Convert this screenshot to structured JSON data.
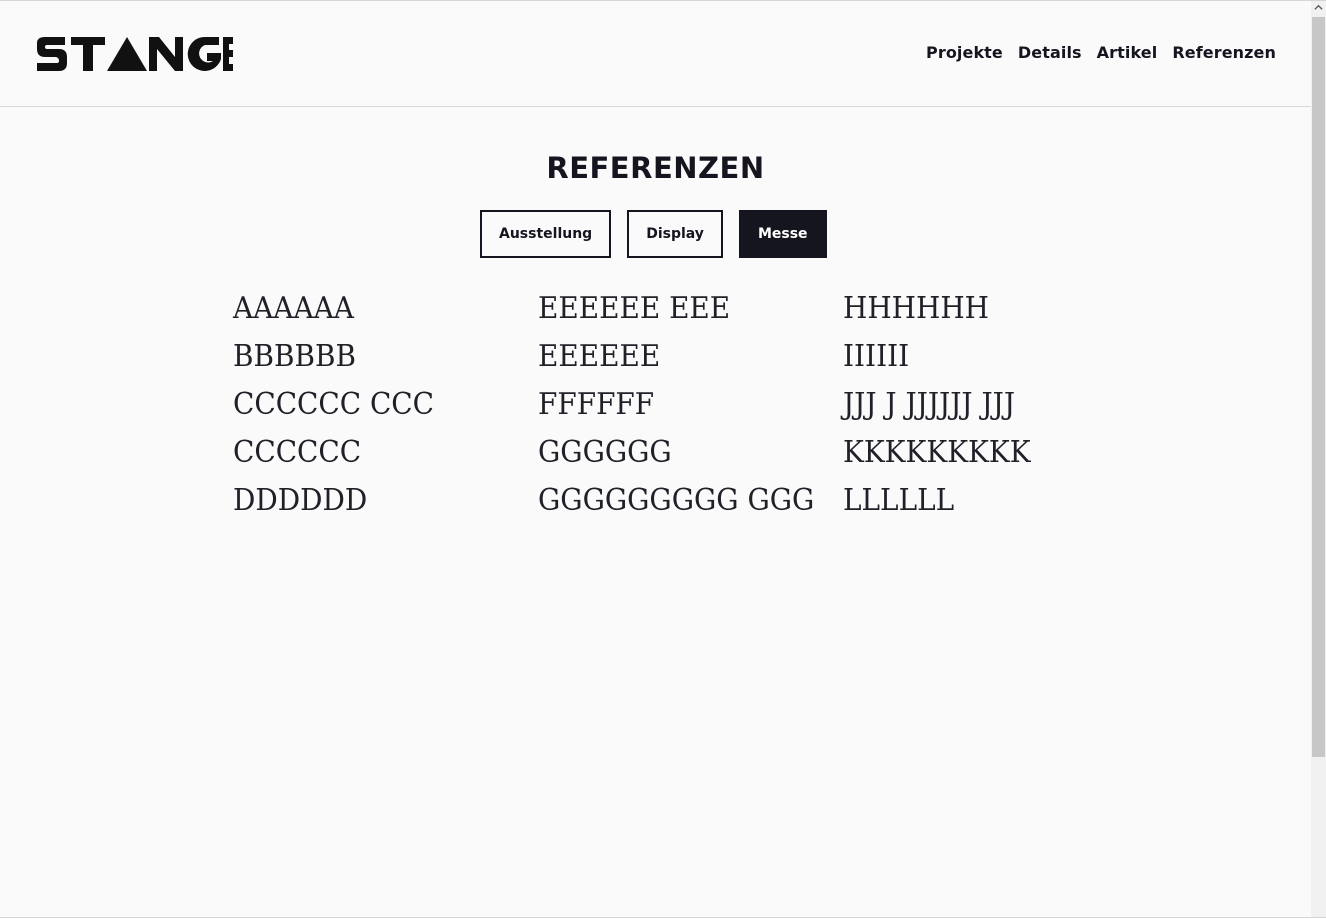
{
  "header": {
    "logo_text": "STANGE",
    "nav": [
      "Projekte",
      "Details",
      "Artikel",
      "Referenzen"
    ]
  },
  "main": {
    "title": "REFERENZEN",
    "filters": [
      {
        "label": "Ausstellung",
        "active": false
      },
      {
        "label": "Display",
        "active": false
      },
      {
        "label": "Messe",
        "active": true
      }
    ],
    "columns": [
      [
        "AAAAAA",
        "BBBBBB",
        "CCCCCC CCC",
        "CCCCCC",
        "DDDDDD"
      ],
      [
        "EEEEEE EEE",
        "EEEEEE",
        "FFFFFF",
        "GGGGGG",
        "GGGGGGGGG GGG"
      ],
      [
        "HHHHHH",
        "IIIIII",
        "JJJ J JJJJJJ JJJ",
        "KKKKKKKKK",
        "LLLLLL"
      ]
    ]
  },
  "colors": {
    "background": "#fafafa",
    "ink": "#151520",
    "active_button_text": "#ffffff"
  },
  "icons": [
    "stange-logo",
    "scroll-up-arrow-icon"
  ]
}
